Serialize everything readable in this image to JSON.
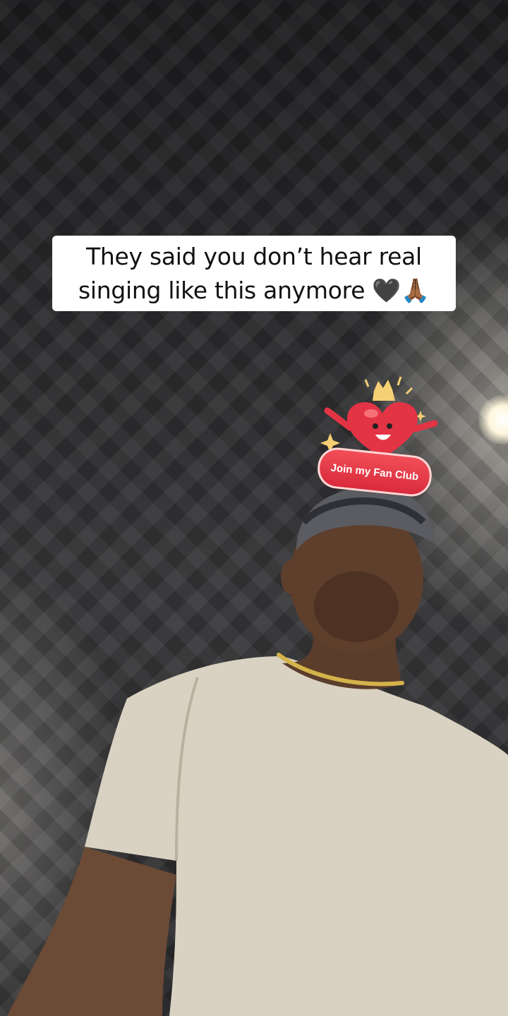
{
  "video": {
    "caption": "They said you don’t hear real singing like this anymore 🖤🙏🏾"
  },
  "sticker": {
    "label": "Join my Fan Club",
    "icon": "heart-mascot-icon",
    "accent": "#e33445"
  }
}
